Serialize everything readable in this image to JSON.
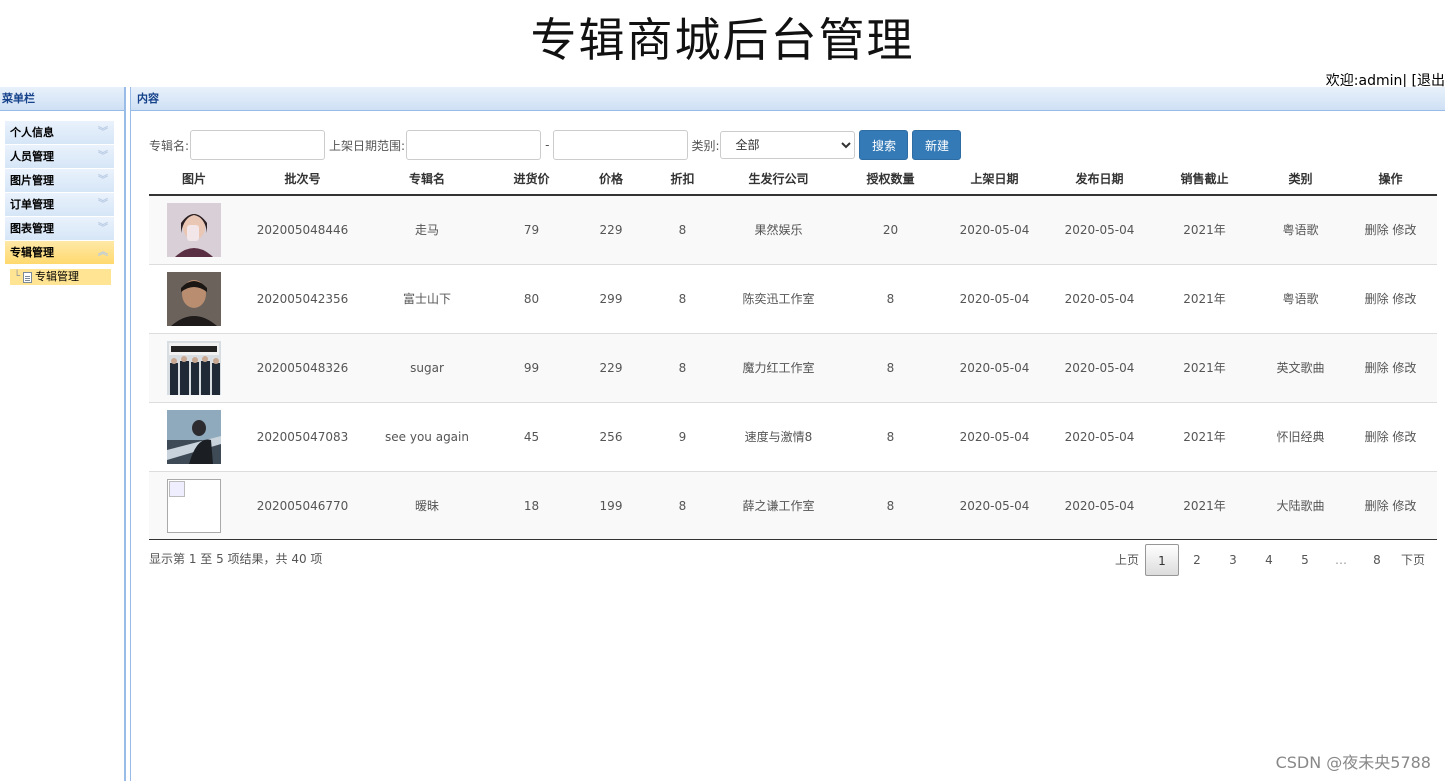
{
  "app": {
    "title": "专辑商城后台管理",
    "welcome": "欢迎:admin| [退出"
  },
  "sidebar": {
    "header": "菜单栏",
    "items": [
      {
        "label": "个人信息",
        "active": false
      },
      {
        "label": "人员管理",
        "active": false
      },
      {
        "label": "图片管理",
        "active": false
      },
      {
        "label": "订单管理",
        "active": false
      },
      {
        "label": "图表管理",
        "active": false
      },
      {
        "label": "专辑管理",
        "active": true
      }
    ],
    "sub_item": "专辑管理"
  },
  "content": {
    "header": "内容"
  },
  "search": {
    "album_label": "专辑名:",
    "album_value": "",
    "date_label": "上架日期范围:",
    "date_from": "",
    "date_sep": "-",
    "date_to": "",
    "category_label": "类别:",
    "category_selected": "全部",
    "search_button": "搜索",
    "new_button": "新建"
  },
  "table": {
    "columns": [
      "图片",
      "批次号",
      "专辑名",
      "进货价",
      "价格",
      "折扣",
      "生发行公司",
      "授权数量",
      "上架日期",
      "发布日期",
      "销售截止",
      "类别",
      "操作"
    ],
    "rows": [
      {
        "image": "woman-portrait",
        "batch": "202005048446",
        "name": "走马",
        "cost": "79",
        "price": "229",
        "discount": "8",
        "company": "果然娱乐",
        "licenses": "20",
        "shelf_date": "2020-05-04",
        "release_date": "2020-05-04",
        "sale_end": "2021年",
        "category": "粤语歌",
        "delete": "删除",
        "edit": "修改"
      },
      {
        "image": "man-portrait",
        "batch": "202005042356",
        "name": "富士山下",
        "cost": "80",
        "price": "299",
        "discount": "8",
        "company": "陈奕迅工作室",
        "licenses": "8",
        "shelf_date": "2020-05-04",
        "release_date": "2020-05-04",
        "sale_end": "2021年",
        "category": "粤语歌",
        "delete": "删除",
        "edit": "修改"
      },
      {
        "image": "band-photo",
        "batch": "202005048326",
        "name": "sugar",
        "cost": "99",
        "price": "229",
        "discount": "8",
        "company": "魔力红工作室",
        "licenses": "8",
        "shelf_date": "2020-05-04",
        "release_date": "2020-05-04",
        "sale_end": "2021年",
        "category": "英文歌曲",
        "delete": "删除",
        "edit": "修改"
      },
      {
        "image": "car-scene",
        "batch": "202005047083",
        "name": "see you again",
        "cost": "45",
        "price": "256",
        "discount": "9",
        "company": "速度与激情8",
        "licenses": "8",
        "shelf_date": "2020-05-04",
        "release_date": "2020-05-04",
        "sale_end": "2021年",
        "category": "怀旧经典",
        "delete": "删除",
        "edit": "修改"
      },
      {
        "image": "broken-image",
        "batch": "202005046770",
        "name": "暧昧",
        "cost": "18",
        "price": "199",
        "discount": "8",
        "company": "薛之谦工作室",
        "licenses": "8",
        "shelf_date": "2020-05-04",
        "release_date": "2020-05-04",
        "sale_end": "2021年",
        "category": "大陆歌曲",
        "delete": "删除",
        "edit": "修改"
      }
    ]
  },
  "summary": "显示第 1 至 5 项结果，共 40 项",
  "pager": {
    "prev": "上页",
    "pages": [
      "1",
      "2",
      "3",
      "4",
      "5"
    ],
    "current": "1",
    "ellipsis": "…",
    "last": "8",
    "next": "下页"
  },
  "watermark": "CSDN @夜未央5788"
}
